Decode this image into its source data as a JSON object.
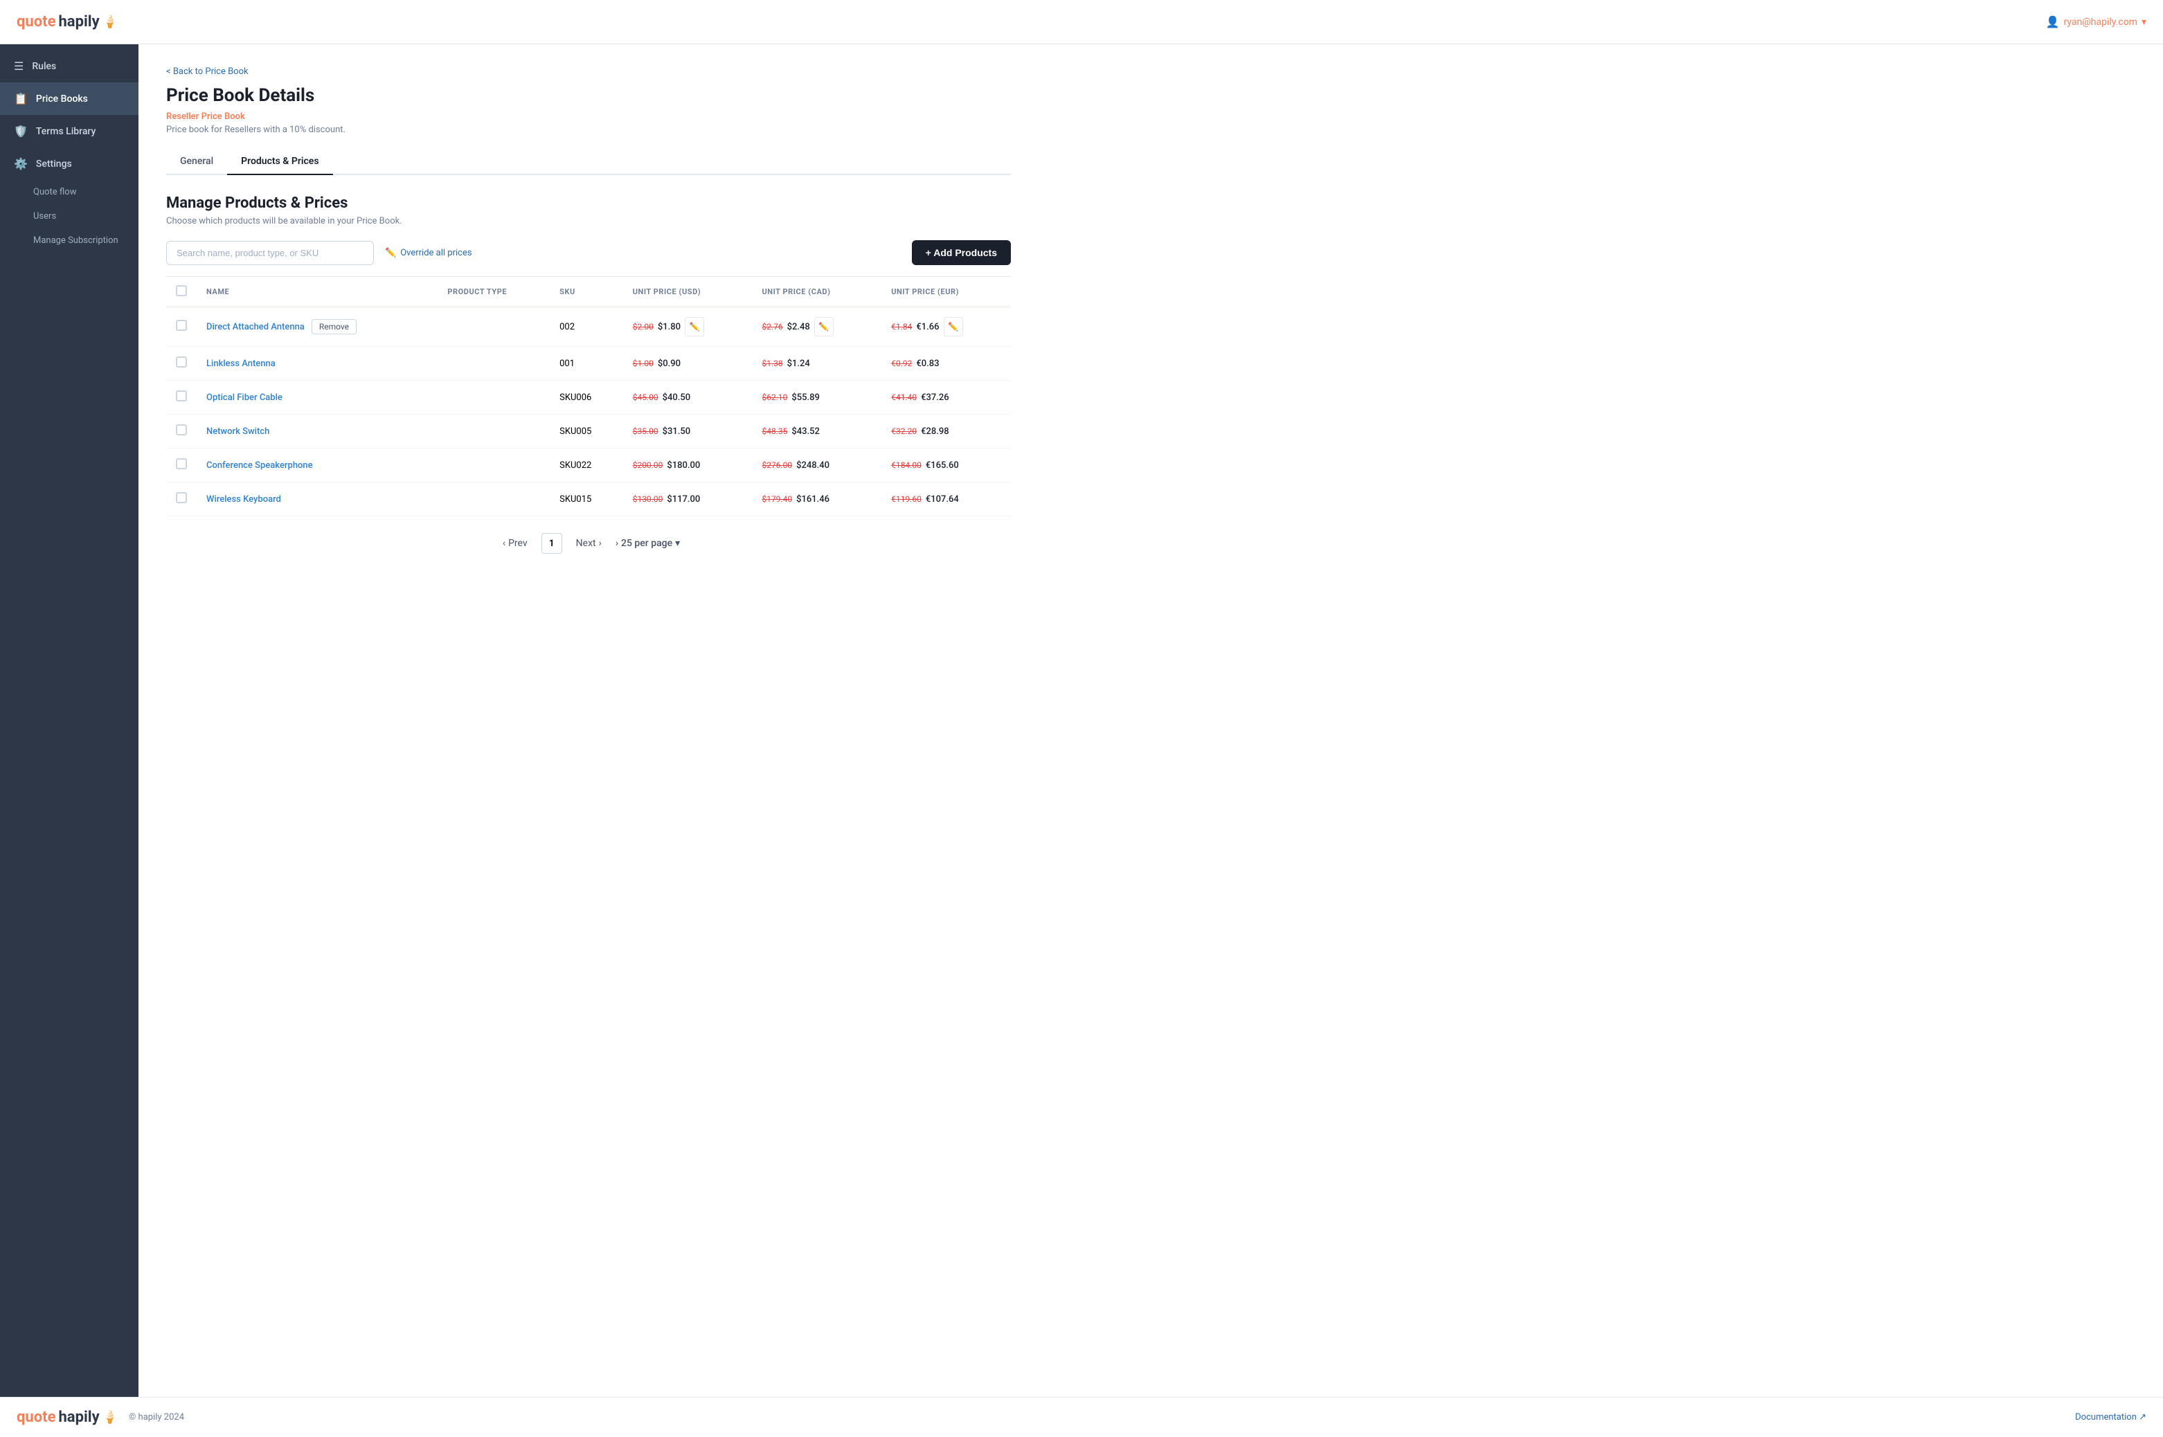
{
  "header": {
    "logo_quote": "quote",
    "logo_hapily": " hapily",
    "logo_icon": "🍦",
    "user_email": "ryan@hapily.com",
    "user_icon": "👤"
  },
  "sidebar": {
    "items": [
      {
        "id": "rules",
        "label": "Rules",
        "icon": "☰",
        "active": false
      },
      {
        "id": "price-books",
        "label": "Price Books",
        "icon": "📋",
        "active": true
      },
      {
        "id": "terms-library",
        "label": "Terms Library",
        "icon": "🛡️",
        "active": false
      },
      {
        "id": "settings",
        "label": "Settings",
        "icon": "⚙️",
        "active": false
      }
    ],
    "sub_items": [
      {
        "id": "quote-flow",
        "label": "Quote flow"
      },
      {
        "id": "users",
        "label": "Users"
      },
      {
        "id": "manage-subscription",
        "label": "Manage Subscription"
      }
    ]
  },
  "content": {
    "back_link": "< Back to Price Book",
    "page_title": "Price Book Details",
    "price_book_name": "Reseller Price Book",
    "price_book_desc": "Price book for Resellers with a 10% discount.",
    "tabs": [
      {
        "id": "general",
        "label": "General",
        "active": false
      },
      {
        "id": "products-prices",
        "label": "Products & Prices",
        "active": true
      }
    ],
    "section_title": "Manage Products & Prices",
    "section_desc": "Choose which products will be available in your Price Book.",
    "search_placeholder": "Search name, product type, or SKU",
    "override_link": "Override all prices",
    "add_products_btn": "+ Add Products",
    "table": {
      "headers": [
        {
          "id": "checkbox",
          "label": ""
        },
        {
          "id": "name",
          "label": "NAME"
        },
        {
          "id": "product-type",
          "label": "PRODUCT TYPE"
        },
        {
          "id": "sku",
          "label": "SKU"
        },
        {
          "id": "unit-price-usd",
          "label": "UNIT PRICE (USD)"
        },
        {
          "id": "unit-price-cad",
          "label": "UNIT PRICE (CAD)"
        },
        {
          "id": "unit-price-eur",
          "label": "UNIT PRICE (EUR)"
        }
      ],
      "rows": [
        {
          "id": "row-1",
          "name": "Direct Attached Antenna",
          "has_remove": true,
          "product_type": "",
          "sku": "002",
          "usd_original": "$2.00",
          "usd_current": "$1.80",
          "usd_editable": true,
          "cad_original": "$2.76",
          "cad_current": "$2.48",
          "cad_editable": true,
          "eur_original": "€1.84",
          "eur_current": "€1.66",
          "eur_editable": true
        },
        {
          "id": "row-2",
          "name": "Linkless Antenna",
          "has_remove": false,
          "product_type": "",
          "sku": "001",
          "usd_original": "$1.00",
          "usd_current": "$0.90",
          "usd_editable": false,
          "cad_original": "$1.38",
          "cad_current": "$1.24",
          "cad_editable": false,
          "eur_original": "€0.92",
          "eur_current": "€0.83",
          "eur_editable": false
        },
        {
          "id": "row-3",
          "name": "Optical Fiber Cable",
          "has_remove": false,
          "product_type": "",
          "sku": "SKU006",
          "usd_original": "$45.00",
          "usd_current": "$40.50",
          "usd_editable": false,
          "cad_original": "$62.10",
          "cad_current": "$55.89",
          "cad_editable": false,
          "eur_original": "€41.40",
          "eur_current": "€37.26",
          "eur_editable": false
        },
        {
          "id": "row-4",
          "name": "Network Switch",
          "has_remove": false,
          "product_type": "",
          "sku": "SKU005",
          "usd_original": "$35.00",
          "usd_current": "$31.50",
          "usd_editable": false,
          "cad_original": "$48.35",
          "cad_current": "$43.52",
          "cad_editable": false,
          "eur_original": "€32.20",
          "eur_current": "€28.98",
          "eur_editable": false
        },
        {
          "id": "row-5",
          "name": "Conference Speakerphone",
          "has_remove": false,
          "product_type": "",
          "sku": "SKU022",
          "usd_original": "$200.00",
          "usd_current": "$180.00",
          "usd_editable": false,
          "cad_original": "$276.00",
          "cad_current": "$248.40",
          "cad_editable": false,
          "eur_original": "€184.00",
          "eur_current": "€165.60",
          "eur_editable": false
        },
        {
          "id": "row-6",
          "name": "Wireless Keyboard",
          "has_remove": false,
          "product_type": "",
          "sku": "SKU015",
          "usd_original": "$130.00",
          "usd_current": "$117.00",
          "usd_editable": false,
          "cad_original": "$179.40",
          "cad_current": "$161.46",
          "cad_editable": false,
          "eur_original": "€119.60",
          "eur_current": "€107.64",
          "eur_editable": false
        }
      ]
    },
    "pagination": {
      "prev": "Prev",
      "next": "Next",
      "current_page": "1",
      "per_page": "25 per page"
    }
  },
  "footer": {
    "logo_quote": "quote",
    "logo_hapily": " hapily",
    "logo_icon": "🍦",
    "copyright": "© hapily 2024",
    "doc_link": "Documentation ↗"
  }
}
